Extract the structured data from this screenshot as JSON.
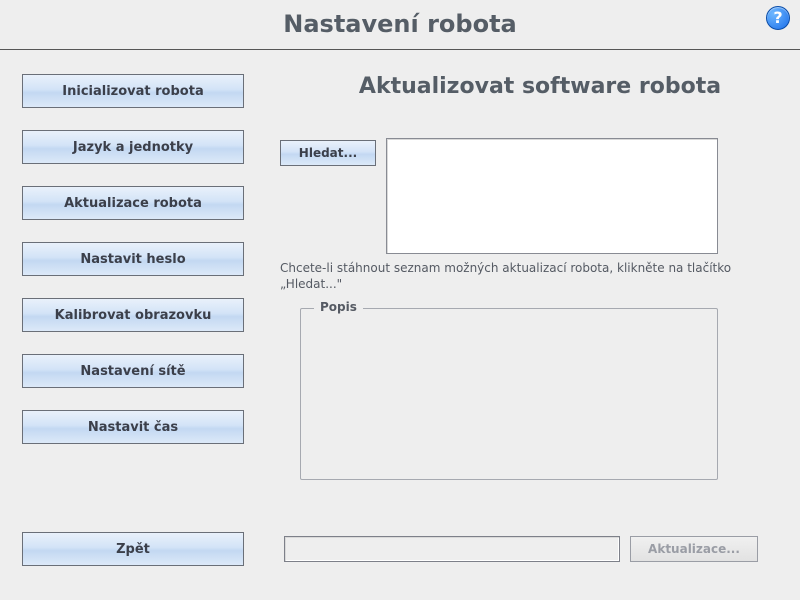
{
  "header": {
    "title": "Nastavení robota"
  },
  "sidebar": {
    "items": [
      {
        "label": "Inicializovat robota"
      },
      {
        "label": "Jazyk a jednotky"
      },
      {
        "label": "Aktualizace robota"
      },
      {
        "label": "Nastavit heslo"
      },
      {
        "label": "Kalibrovat obrazovku"
      },
      {
        "label": "Nastavení sítě"
      },
      {
        "label": "Nastavit čas"
      }
    ],
    "back_label": "Zpět"
  },
  "content": {
    "title": "Aktualizovat software robota",
    "search_label": "Hledat...",
    "hint": "Chcete-li stáhnout seznam možných aktualizací robota, klikněte na tlačítko „Hledat...\"",
    "description_group_label": "Popis",
    "update_button_label": "Aktualizace..."
  }
}
